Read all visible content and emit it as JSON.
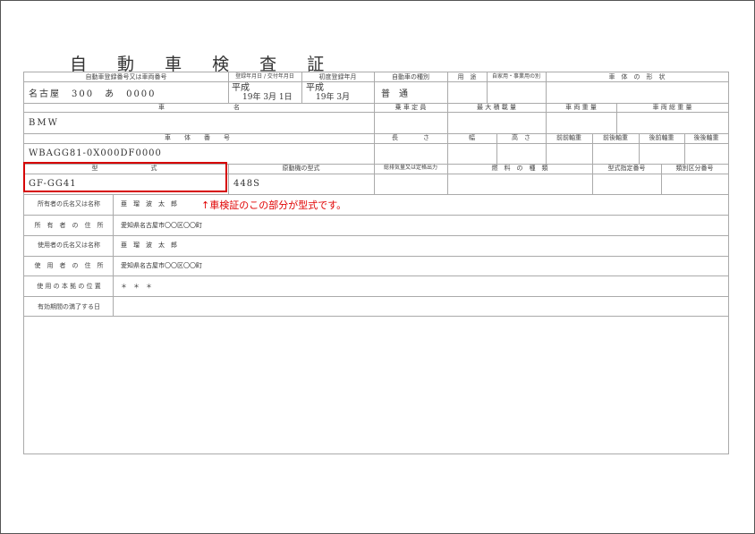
{
  "title": "自 動 車 検 査 証",
  "header1": {
    "reg_number_label": "自動車登録番号又は車両番号",
    "reg_date_label": "登録年月日 / 交付年月日",
    "first_reg_label": "初度登録年月",
    "vehicle_kind_label": "自動車の種別",
    "usage_label": "用　途",
    "private_label": "自家用・事業用の別",
    "body_shape_label": "車　体　の　形　状"
  },
  "row1": {
    "reg_number": "名古屋　300　あ　0000",
    "reg_era": "平成",
    "reg_date_nums": "19年 3月 1日",
    "first_era": "平成",
    "first_date_nums": "19年 3月",
    "vehicle_kind": "普　通"
  },
  "header2": {
    "name_label": "車　　　　　　　　　　　名",
    "capacity_label": "乗 車 定 員",
    "max_load_label": "最 大 積 載 量",
    "weight_label": "車 両 重 量",
    "gross_weight_label": "車 両 総 重 量"
  },
  "row2": {
    "car_name": "BMW"
  },
  "header3": {
    "chassis_label": "車　体　番　号",
    "length_label": "長　　　　さ",
    "width_label": "幅",
    "height_label": "高　さ",
    "ff_axle_label": "前前軸重",
    "fr_axle_label": "前後軸重",
    "rf_axle_label": "後前軸重",
    "rr_axle_label": "後後軸重"
  },
  "row3": {
    "chassis_number": "WBAGG81-0X000DF0000"
  },
  "header4": {
    "model_label": "型　　　　　式",
    "engine_label": "原動機の型式",
    "displacement_label": "総排気量又は定格出力",
    "fuel_label": "燃　料　の　種　類",
    "model_designation_label": "型式指定番号",
    "category_label": "類別区分番号"
  },
  "row4": {
    "model": "GF-GG41",
    "engine": "448S"
  },
  "rows": [
    {
      "label": "所有者の氏名又は名称",
      "value": "亜　瑠　波　太　郎"
    },
    {
      "label": "所　有　者　の　住　所",
      "value": "愛知県名古屋市〇〇区〇〇町"
    },
    {
      "label": "使用者の氏名又は名称",
      "value": "亜　瑠　波　太　郎"
    },
    {
      "label": "使　用　者　の　住　所",
      "value": "愛知県名古屋市〇〇区〇〇町"
    },
    {
      "label": "使 用 の 本 拠 の 位 置",
      "value": "＊　＊　＊"
    },
    {
      "label": "有効期間の満了する日",
      "value": ""
    }
  ],
  "annotation": "↑車検証のこの部分が型式です。",
  "colors": {
    "highlight": "#d60000",
    "annotation": "#e00000",
    "rule": "#aaaaaa"
  }
}
